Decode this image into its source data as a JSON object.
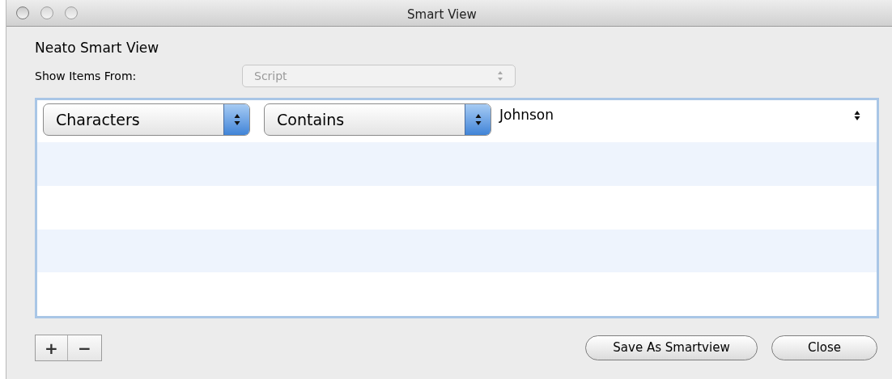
{
  "window": {
    "title": "Smart View"
  },
  "heading": "Neato Smart View",
  "source": {
    "label": "Show Items From:",
    "value": "Script",
    "disabled": true
  },
  "rules": [
    {
      "field": "Characters",
      "operator": "Contains",
      "value": "Johnson"
    }
  ],
  "row_buttons": [
    "+",
    "−"
  ],
  "buttons": [
    "Save As Smartview",
    "Close"
  ]
}
